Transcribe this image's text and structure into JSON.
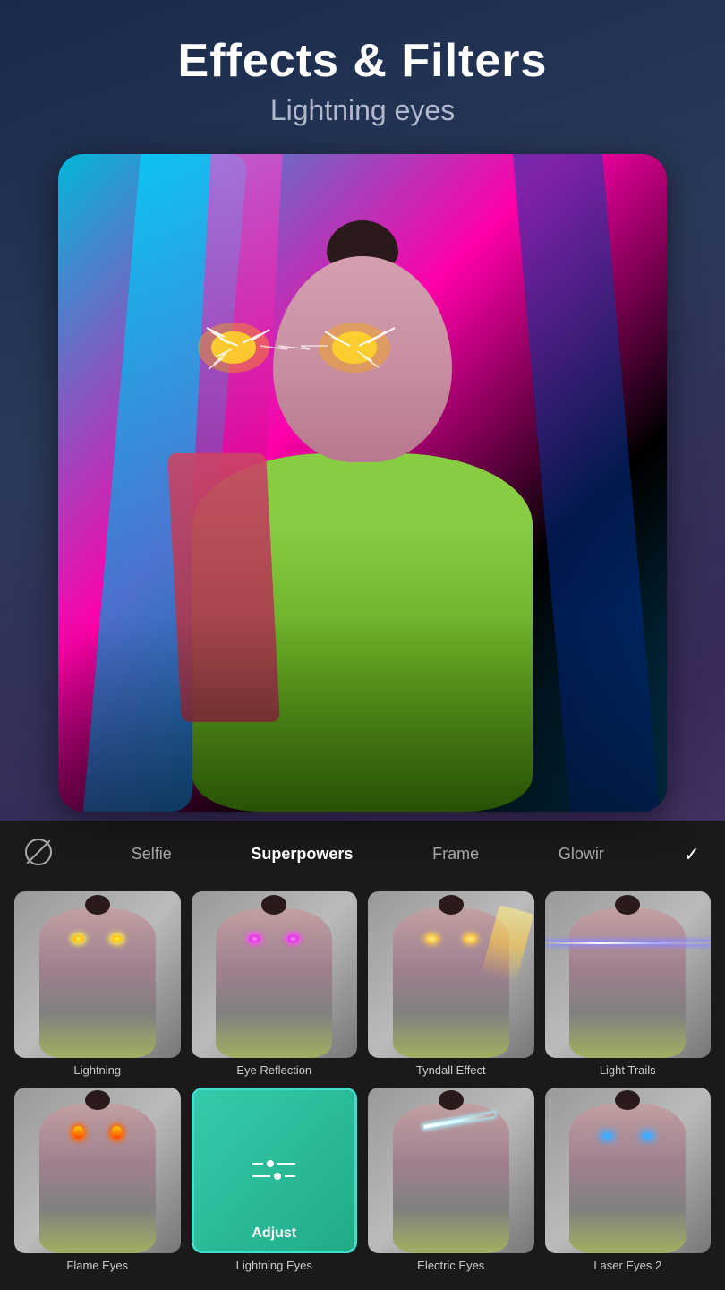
{
  "header": {
    "title": "Effects & Filters",
    "subtitle": "Lightning eyes"
  },
  "controls": {
    "no_icon_label": "⊘",
    "selfie": "Selfie",
    "superpowers": "Superpowers",
    "frame": "Frame",
    "glowin": "Glowir",
    "check": "✓"
  },
  "effects": [
    {
      "id": "lightning",
      "label": "Lightning",
      "type": "lightning",
      "selected": false
    },
    {
      "id": "eye-reflection",
      "label": "Eye Reflection",
      "type": "pink-eyes",
      "selected": false
    },
    {
      "id": "tyndall-effect",
      "label": "Tyndall Effect",
      "type": "tyndall",
      "selected": false
    },
    {
      "id": "light-trails",
      "label": "Light Trails",
      "type": "light-trails",
      "selected": false
    },
    {
      "id": "flame-eyes",
      "label": "Flame Eyes",
      "type": "fire-eyes",
      "selected": false
    },
    {
      "id": "lightning-eyes",
      "label": "Lightning Eyes",
      "type": "adjust",
      "selected": true
    },
    {
      "id": "electric-eyes",
      "label": "Electric Eyes",
      "type": "electric",
      "selected": false
    },
    {
      "id": "laser-eyes-2",
      "label": "Laser Eyes 2",
      "type": "laser",
      "selected": false
    }
  ]
}
